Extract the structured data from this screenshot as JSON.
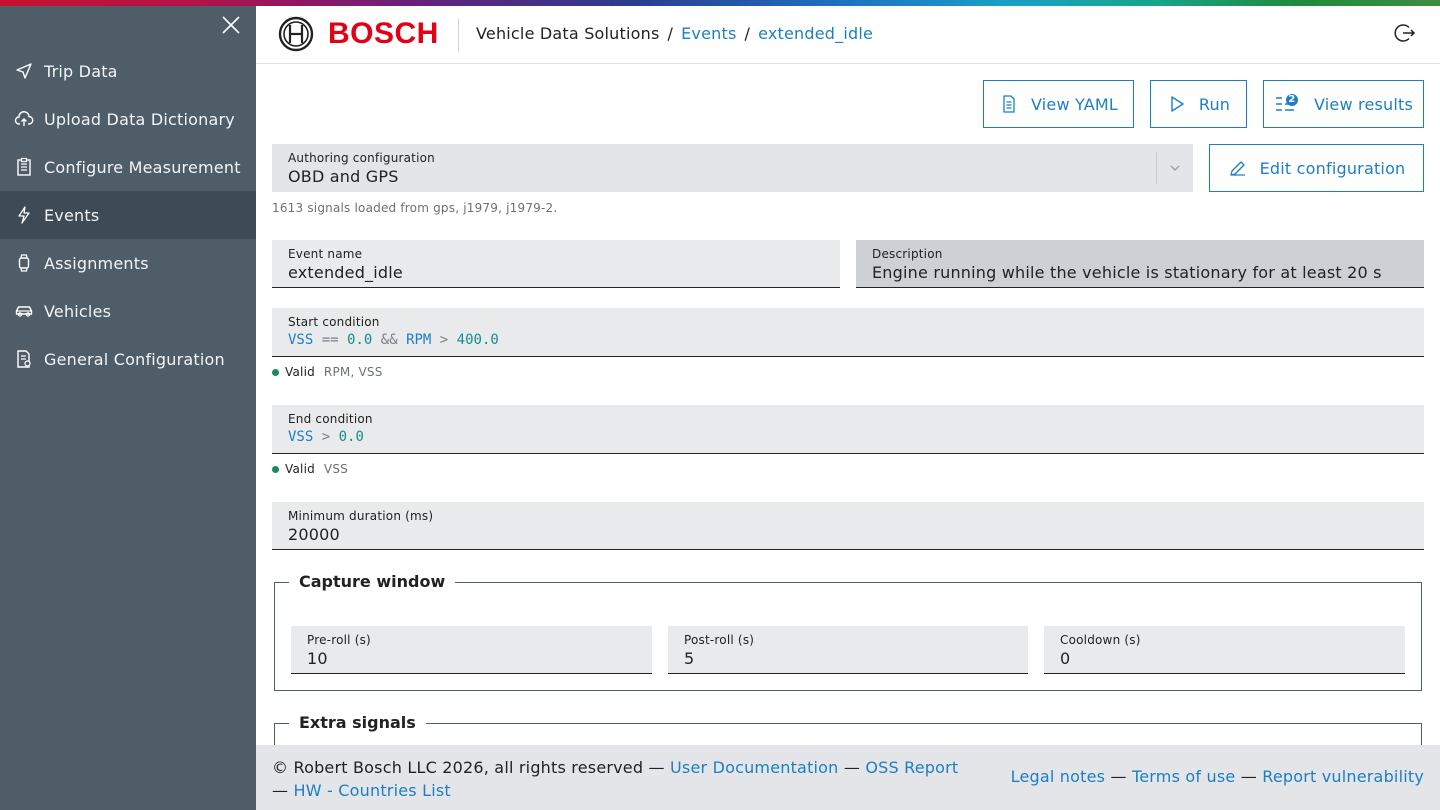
{
  "brand": {
    "name": "BOSCH",
    "accent": "#e20015",
    "link_color": "#1d7fc2"
  },
  "sidebar": {
    "items": [
      {
        "label": "Trip Data",
        "icon": "send-icon"
      },
      {
        "label": "Upload Data Dictionary",
        "icon": "cloud-upload-icon"
      },
      {
        "label": "Configure Measurement",
        "icon": "clipboard-icon"
      },
      {
        "label": "Events",
        "icon": "lightning-icon",
        "active": true
      },
      {
        "label": "Assignments",
        "icon": "watch-icon"
      },
      {
        "label": "Vehicles",
        "icon": "car-icon"
      },
      {
        "label": "General Configuration",
        "icon": "settings-doc-icon"
      }
    ]
  },
  "header": {
    "breadcrumb": {
      "root": "Vehicle Data Solutions",
      "sep": "/",
      "section": "Events",
      "current": "extended_idle"
    }
  },
  "toolbar": {
    "view_yaml": "View YAML",
    "run": "Run",
    "view_results": "View results",
    "results_badge": "2"
  },
  "authoring": {
    "label": "Authoring configuration",
    "value": "OBD and GPS",
    "hint": "1613 signals loaded from gps, j1979, j1979-2.",
    "edit_label": "Edit configuration"
  },
  "event": {
    "name_label": "Event name",
    "name_value": "extended_idle",
    "desc_label": "Description",
    "desc_value": "Engine running while the vehicle is stationary for at least 20 s"
  },
  "start_condition": {
    "label": "Start condition",
    "tokens": {
      "s1": "VSS",
      "o1": "==",
      "n1": "0.0",
      "o2": "&&",
      "s2": "RPM",
      "o3": ">",
      "n2": "400.0"
    },
    "status": "Valid",
    "signals": "RPM, VSS"
  },
  "end_condition": {
    "label": "End condition",
    "tokens": {
      "s1": "VSS",
      "o1": ">",
      "n1": "0.0"
    },
    "status": "Valid",
    "signals": "VSS"
  },
  "min_duration": {
    "label": "Minimum duration (ms)",
    "value": "20000"
  },
  "capture_window": {
    "title": "Capture window",
    "pre_roll": {
      "label": "Pre-roll (s)",
      "value": "10"
    },
    "post_roll": {
      "label": "Post-roll (s)",
      "value": "5"
    },
    "cooldown": {
      "label": "Cooldown (s)",
      "value": "0"
    }
  },
  "extra_signals": {
    "title": "Extra signals"
  },
  "footer": {
    "copyright": "© Robert Bosch LLC 2026, all rights reserved",
    "dash": "—",
    "user_docs": "User Documentation",
    "oss_report": "OSS Report",
    "hw_list": "HW - Countries List",
    "legal": "Legal notes",
    "terms": "Terms of use",
    "report_vuln": "Report vulnerability"
  }
}
